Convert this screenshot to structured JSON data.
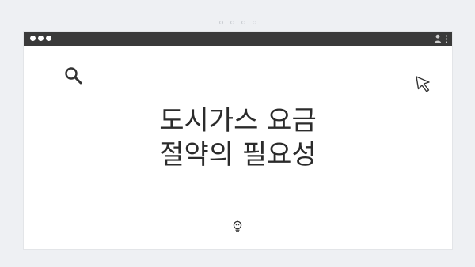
{
  "window": {
    "title_lines": [
      "도시가스 요금",
      "절약의 필요성"
    ]
  },
  "icons": {
    "search": "search-icon",
    "cursor": "cursor-icon",
    "bulb": "lightbulb-icon",
    "user": "user-icon",
    "menu": "menu-dots-icon"
  },
  "colors": {
    "titlebar": "#3a3a3a",
    "background": "#eef0f3",
    "text": "#2b2b2b"
  }
}
